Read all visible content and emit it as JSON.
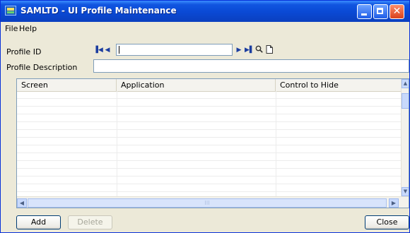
{
  "window": {
    "title": "SAMLTD - UI Profile Maintenance",
    "controls": {
      "minimize": "",
      "maximize": "",
      "close": "✕"
    }
  },
  "menu": {
    "file": "File",
    "help": "Help"
  },
  "form": {
    "profile_id_label": "Profile ID",
    "profile_id_value": "",
    "profile_description_label": "Profile Description",
    "profile_description_value": "",
    "nav_icons": [
      "first-record-icon",
      "previous-record-icon",
      "next-record-icon",
      "last-record-icon",
      "lookup-icon",
      "new-record-icon"
    ]
  },
  "grid": {
    "columns": [
      "Screen",
      "Application",
      "Control to Hide"
    ],
    "rows": []
  },
  "buttons": {
    "add": "Add",
    "delete": "Delete",
    "close": "Close"
  },
  "colors": {
    "titlebar": "#0a4ad6",
    "window_bg": "#ece9d8",
    "nav_arrows": "#1b3d9f"
  }
}
